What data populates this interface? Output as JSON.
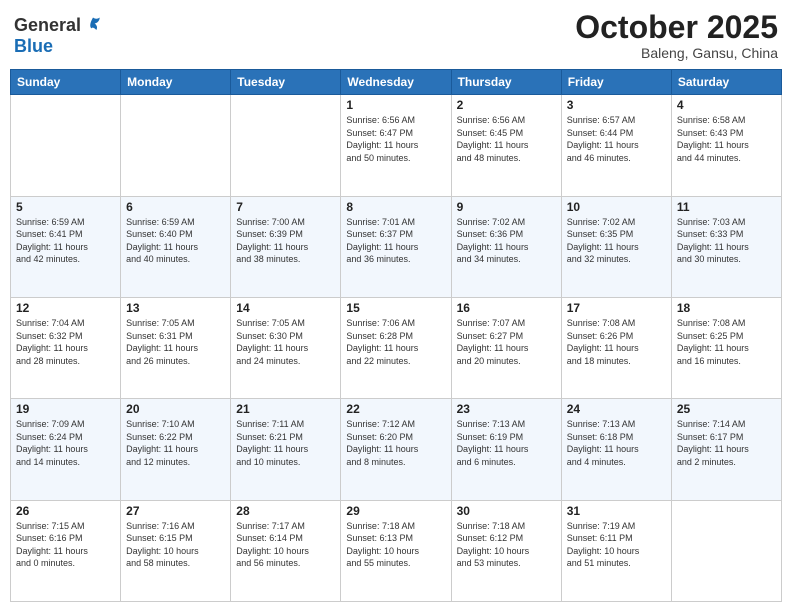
{
  "header": {
    "logo_general": "General",
    "logo_blue": "Blue",
    "title": "October 2025",
    "subtitle": "Baleng, Gansu, China"
  },
  "days_of_week": [
    "Sunday",
    "Monday",
    "Tuesday",
    "Wednesday",
    "Thursday",
    "Friday",
    "Saturday"
  ],
  "weeks": [
    [
      {
        "day": "",
        "info": ""
      },
      {
        "day": "",
        "info": ""
      },
      {
        "day": "",
        "info": ""
      },
      {
        "day": "1",
        "info": "Sunrise: 6:56 AM\nSunset: 6:47 PM\nDaylight: 11 hours\nand 50 minutes."
      },
      {
        "day": "2",
        "info": "Sunrise: 6:56 AM\nSunset: 6:45 PM\nDaylight: 11 hours\nand 48 minutes."
      },
      {
        "day": "3",
        "info": "Sunrise: 6:57 AM\nSunset: 6:44 PM\nDaylight: 11 hours\nand 46 minutes."
      },
      {
        "day": "4",
        "info": "Sunrise: 6:58 AM\nSunset: 6:43 PM\nDaylight: 11 hours\nand 44 minutes."
      }
    ],
    [
      {
        "day": "5",
        "info": "Sunrise: 6:59 AM\nSunset: 6:41 PM\nDaylight: 11 hours\nand 42 minutes."
      },
      {
        "day": "6",
        "info": "Sunrise: 6:59 AM\nSunset: 6:40 PM\nDaylight: 11 hours\nand 40 minutes."
      },
      {
        "day": "7",
        "info": "Sunrise: 7:00 AM\nSunset: 6:39 PM\nDaylight: 11 hours\nand 38 minutes."
      },
      {
        "day": "8",
        "info": "Sunrise: 7:01 AM\nSunset: 6:37 PM\nDaylight: 11 hours\nand 36 minutes."
      },
      {
        "day": "9",
        "info": "Sunrise: 7:02 AM\nSunset: 6:36 PM\nDaylight: 11 hours\nand 34 minutes."
      },
      {
        "day": "10",
        "info": "Sunrise: 7:02 AM\nSunset: 6:35 PM\nDaylight: 11 hours\nand 32 minutes."
      },
      {
        "day": "11",
        "info": "Sunrise: 7:03 AM\nSunset: 6:33 PM\nDaylight: 11 hours\nand 30 minutes."
      }
    ],
    [
      {
        "day": "12",
        "info": "Sunrise: 7:04 AM\nSunset: 6:32 PM\nDaylight: 11 hours\nand 28 minutes."
      },
      {
        "day": "13",
        "info": "Sunrise: 7:05 AM\nSunset: 6:31 PM\nDaylight: 11 hours\nand 26 minutes."
      },
      {
        "day": "14",
        "info": "Sunrise: 7:05 AM\nSunset: 6:30 PM\nDaylight: 11 hours\nand 24 minutes."
      },
      {
        "day": "15",
        "info": "Sunrise: 7:06 AM\nSunset: 6:28 PM\nDaylight: 11 hours\nand 22 minutes."
      },
      {
        "day": "16",
        "info": "Sunrise: 7:07 AM\nSunset: 6:27 PM\nDaylight: 11 hours\nand 20 minutes."
      },
      {
        "day": "17",
        "info": "Sunrise: 7:08 AM\nSunset: 6:26 PM\nDaylight: 11 hours\nand 18 minutes."
      },
      {
        "day": "18",
        "info": "Sunrise: 7:08 AM\nSunset: 6:25 PM\nDaylight: 11 hours\nand 16 minutes."
      }
    ],
    [
      {
        "day": "19",
        "info": "Sunrise: 7:09 AM\nSunset: 6:24 PM\nDaylight: 11 hours\nand 14 minutes."
      },
      {
        "day": "20",
        "info": "Sunrise: 7:10 AM\nSunset: 6:22 PM\nDaylight: 11 hours\nand 12 minutes."
      },
      {
        "day": "21",
        "info": "Sunrise: 7:11 AM\nSunset: 6:21 PM\nDaylight: 11 hours\nand 10 minutes."
      },
      {
        "day": "22",
        "info": "Sunrise: 7:12 AM\nSunset: 6:20 PM\nDaylight: 11 hours\nand 8 minutes."
      },
      {
        "day": "23",
        "info": "Sunrise: 7:13 AM\nSunset: 6:19 PM\nDaylight: 11 hours\nand 6 minutes."
      },
      {
        "day": "24",
        "info": "Sunrise: 7:13 AM\nSunset: 6:18 PM\nDaylight: 11 hours\nand 4 minutes."
      },
      {
        "day": "25",
        "info": "Sunrise: 7:14 AM\nSunset: 6:17 PM\nDaylight: 11 hours\nand 2 minutes."
      }
    ],
    [
      {
        "day": "26",
        "info": "Sunrise: 7:15 AM\nSunset: 6:16 PM\nDaylight: 11 hours\nand 0 minutes."
      },
      {
        "day": "27",
        "info": "Sunrise: 7:16 AM\nSunset: 6:15 PM\nDaylight: 10 hours\nand 58 minutes."
      },
      {
        "day": "28",
        "info": "Sunrise: 7:17 AM\nSunset: 6:14 PM\nDaylight: 10 hours\nand 56 minutes."
      },
      {
        "day": "29",
        "info": "Sunrise: 7:18 AM\nSunset: 6:13 PM\nDaylight: 10 hours\nand 55 minutes."
      },
      {
        "day": "30",
        "info": "Sunrise: 7:18 AM\nSunset: 6:12 PM\nDaylight: 10 hours\nand 53 minutes."
      },
      {
        "day": "31",
        "info": "Sunrise: 7:19 AM\nSunset: 6:11 PM\nDaylight: 10 hours\nand 51 minutes."
      },
      {
        "day": "",
        "info": ""
      }
    ]
  ]
}
